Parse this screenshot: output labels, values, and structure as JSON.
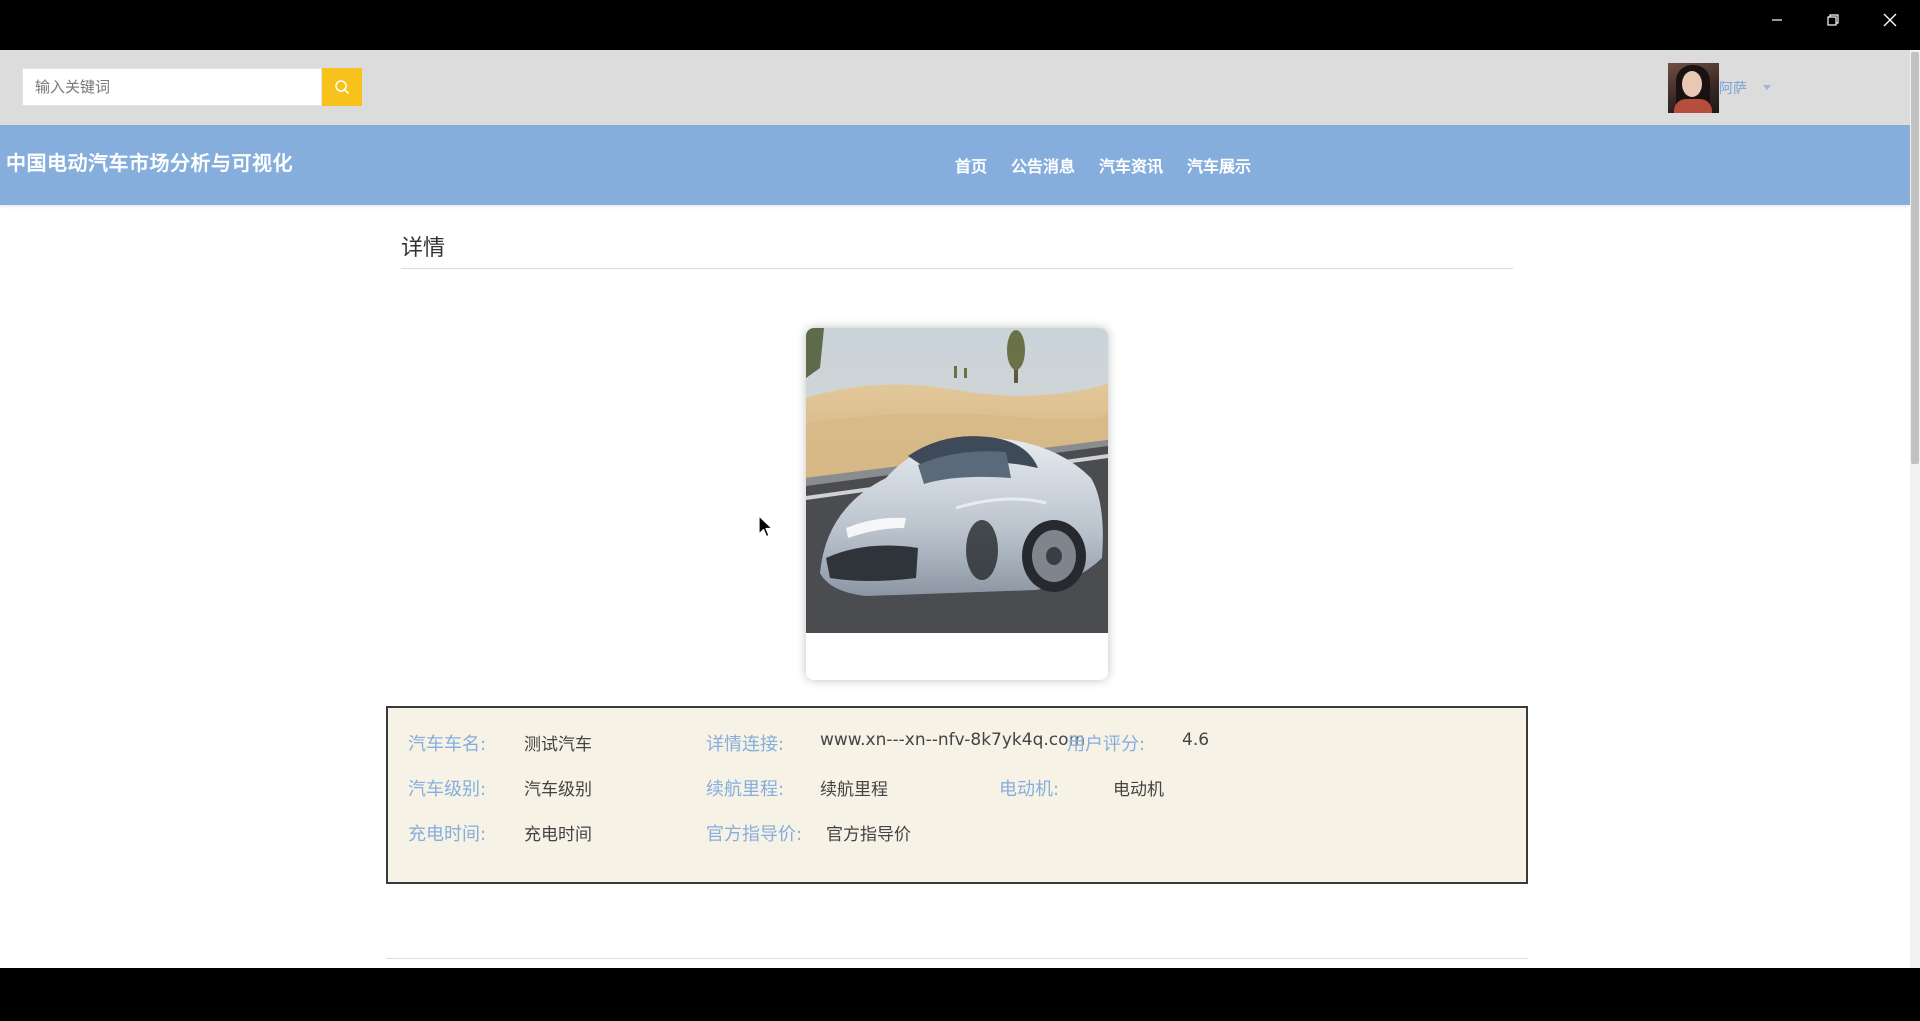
{
  "window": {
    "minimize_icon": "minimize-icon",
    "maximize_icon": "restore-icon",
    "close_icon": "close-icon"
  },
  "header": {
    "search": {
      "placeholder": "输入关键词",
      "value": "",
      "icon": "search-icon",
      "button_color": "#f7c21b"
    },
    "user": {
      "name": "阿萨",
      "avatar": "avatar",
      "caret": "caret-down-icon"
    }
  },
  "nav": {
    "site_title": "中国电动汽车市场分析与可视化",
    "items": [
      {
        "label": "首页"
      },
      {
        "label": "公告消息"
      },
      {
        "label": "汽车资讯"
      },
      {
        "label": "汽车展示"
      }
    ],
    "background": "#86aedd"
  },
  "detail": {
    "heading": "详情",
    "image_alt": "car-photo",
    "fields": [
      {
        "label": "汽车车名:",
        "value": "测试汽车"
      },
      {
        "label": "详情连接:",
        "value": "www.xn---xn--nfv-8k7yk4q.com"
      },
      {
        "label": "用户评分:",
        "value": "4.6"
      },
      {
        "label": "汽车级别:",
        "value": "汽车级别"
      },
      {
        "label": "续航里程:",
        "value": "续航里程"
      },
      {
        "label": "电动机:",
        "value": "电动机"
      },
      {
        "label": "充电时间:",
        "value": "充电时间"
      },
      {
        "label": "官方指导价:",
        "value": "官方指导价"
      }
    ],
    "label_color": "#86aedd",
    "panel_background": "#f6f2e6"
  }
}
